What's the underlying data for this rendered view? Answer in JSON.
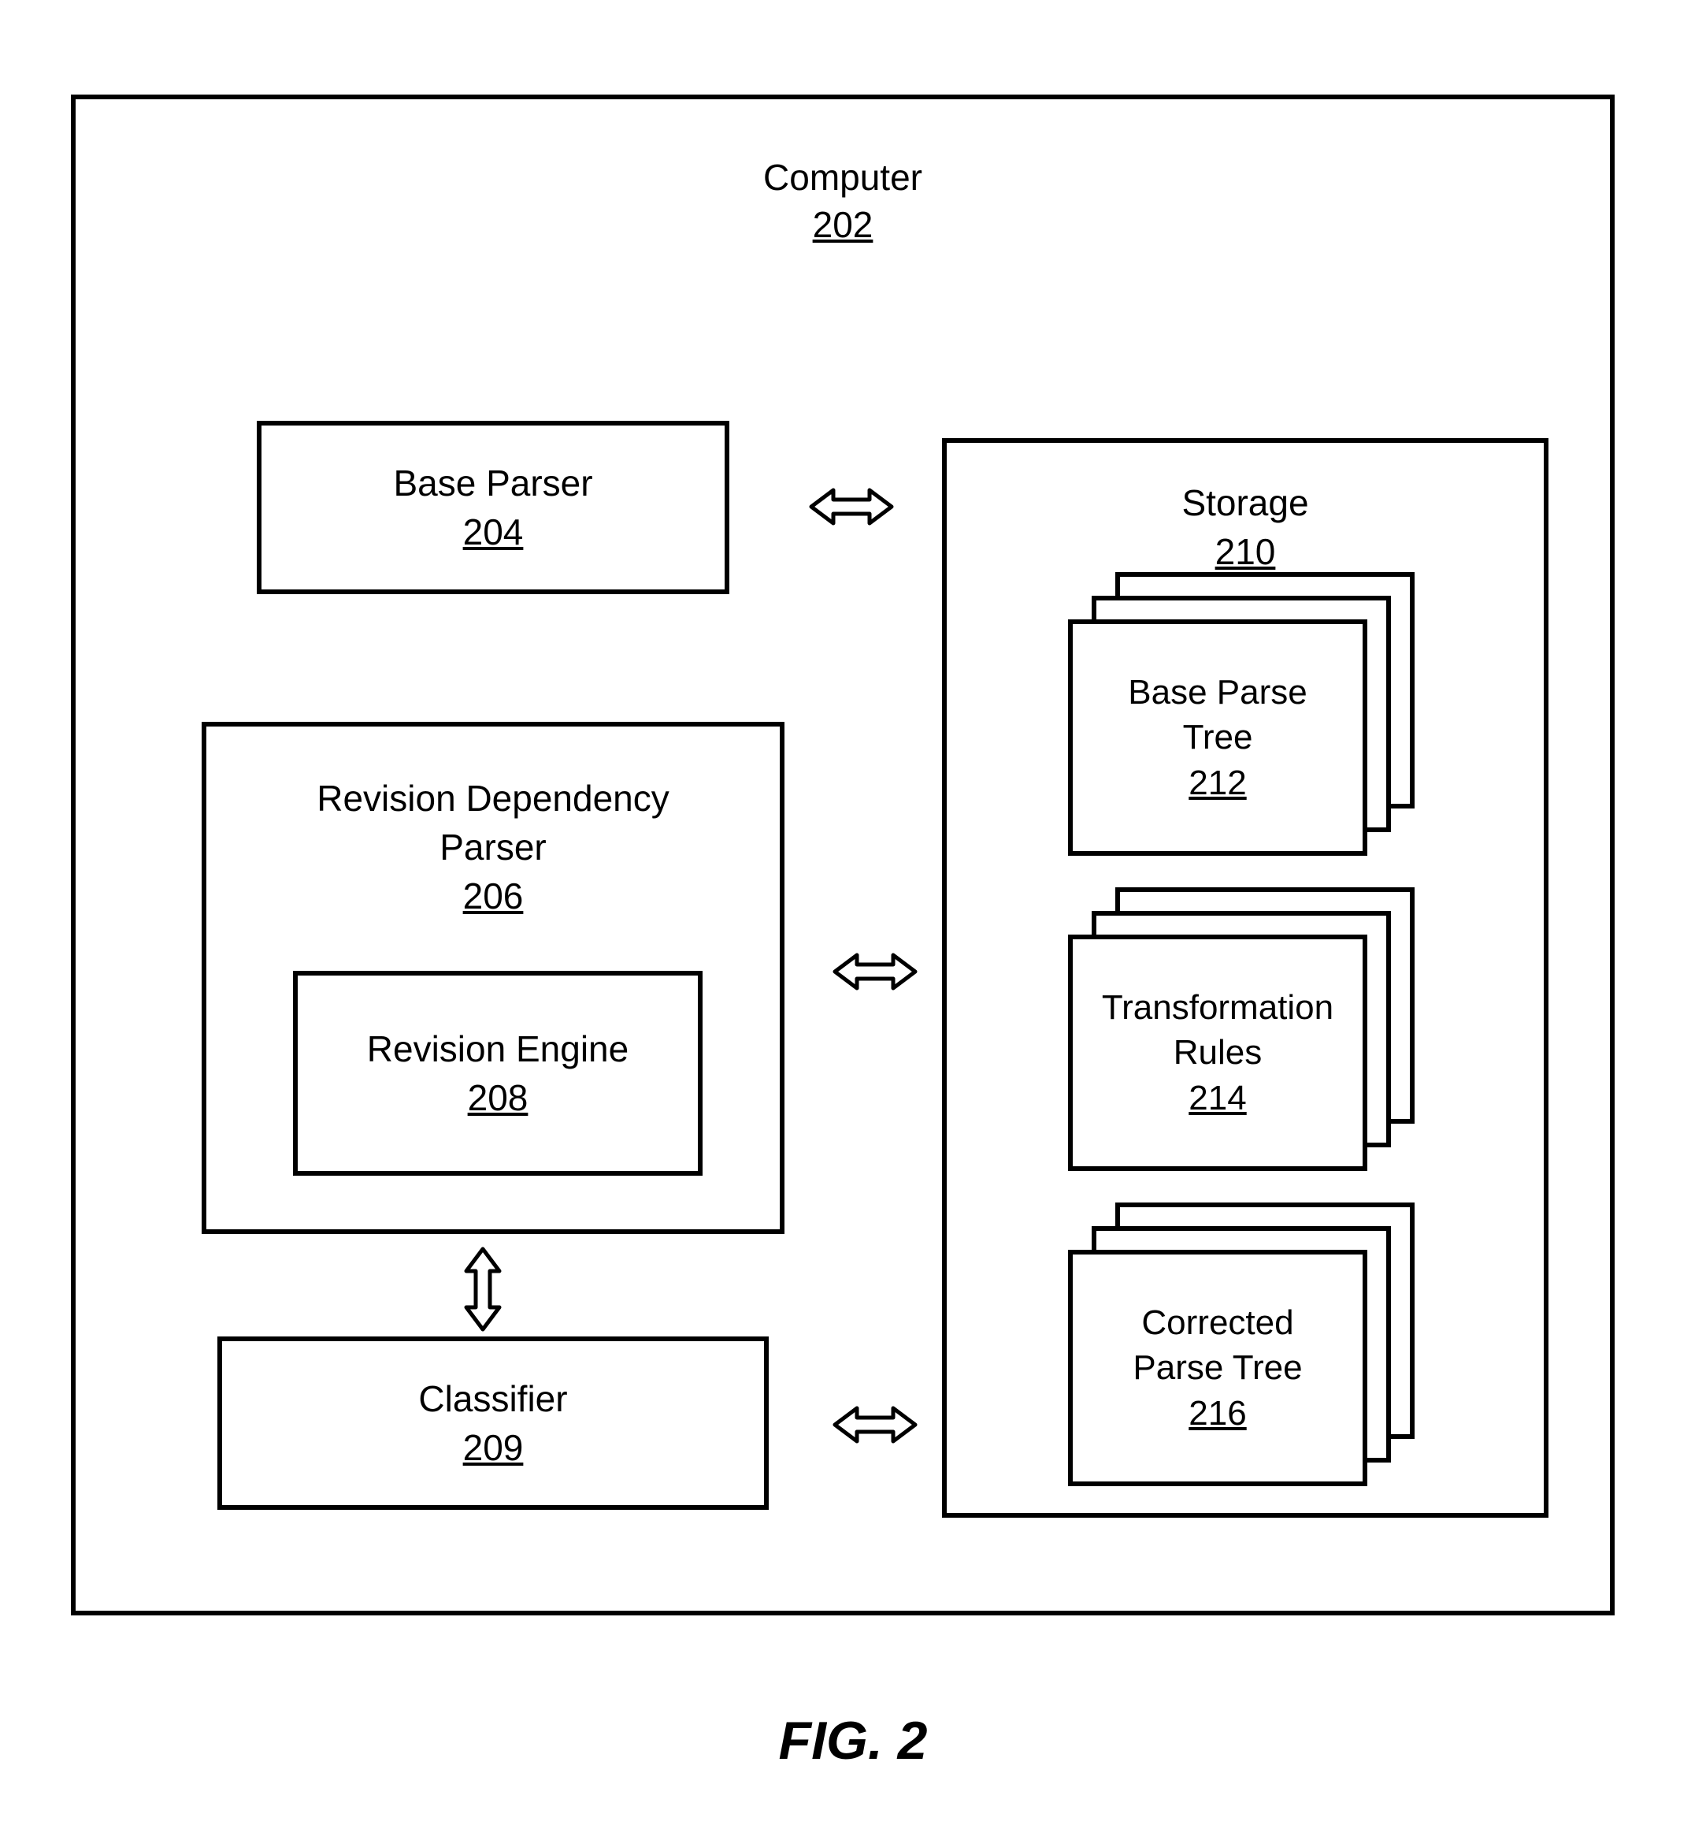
{
  "figure": {
    "caption": "FIG. 2"
  },
  "container": {
    "label": "Computer",
    "ref": "202"
  },
  "blocks": {
    "base_parser": {
      "label": "Base Parser",
      "ref": "204"
    },
    "rev_dep": {
      "label1": "Revision Dependency",
      "label2": "Parser",
      "ref": "206"
    },
    "rev_engine": {
      "label": "Revision Engine",
      "ref": "208"
    },
    "classifier": {
      "label": "Classifier",
      "ref": "209"
    },
    "storage": {
      "label": "Storage",
      "ref": "210"
    }
  },
  "stacks": {
    "base_parse_tree": {
      "line1": "Base Parse",
      "line2": "Tree",
      "ref": "212"
    },
    "transformation_rules": {
      "line1": "Transformation",
      "line2": "Rules",
      "ref": "214"
    },
    "corrected_parse_tree": {
      "line1": "Corrected",
      "line2": "Parse Tree",
      "ref": "216"
    }
  },
  "chart_data": {
    "type": "block-diagram",
    "title": "FIG. 2",
    "nodes": [
      {
        "id": "202",
        "label": "Computer",
        "type": "container",
        "children": [
          "204",
          "206",
          "209",
          "210"
        ]
      },
      {
        "id": "204",
        "label": "Base Parser",
        "type": "component"
      },
      {
        "id": "206",
        "label": "Revision Dependency Parser",
        "type": "component",
        "children": [
          "208"
        ]
      },
      {
        "id": "208",
        "label": "Revision Engine",
        "type": "component"
      },
      {
        "id": "209",
        "label": "Classifier",
        "type": "component"
      },
      {
        "id": "210",
        "label": "Storage",
        "type": "container",
        "children": [
          "212",
          "214",
          "216"
        ]
      },
      {
        "id": "212",
        "label": "Base Parse Tree",
        "type": "document-stack"
      },
      {
        "id": "214",
        "label": "Transformation Rules",
        "type": "document-stack"
      },
      {
        "id": "216",
        "label": "Corrected Parse Tree",
        "type": "document-stack"
      }
    ],
    "edges": [
      {
        "from": "204",
        "to": "210",
        "bidirectional": true
      },
      {
        "from": "206",
        "to": "210",
        "bidirectional": true
      },
      {
        "from": "209",
        "to": "210",
        "bidirectional": true
      },
      {
        "from": "206",
        "to": "209",
        "bidirectional": true
      }
    ]
  }
}
